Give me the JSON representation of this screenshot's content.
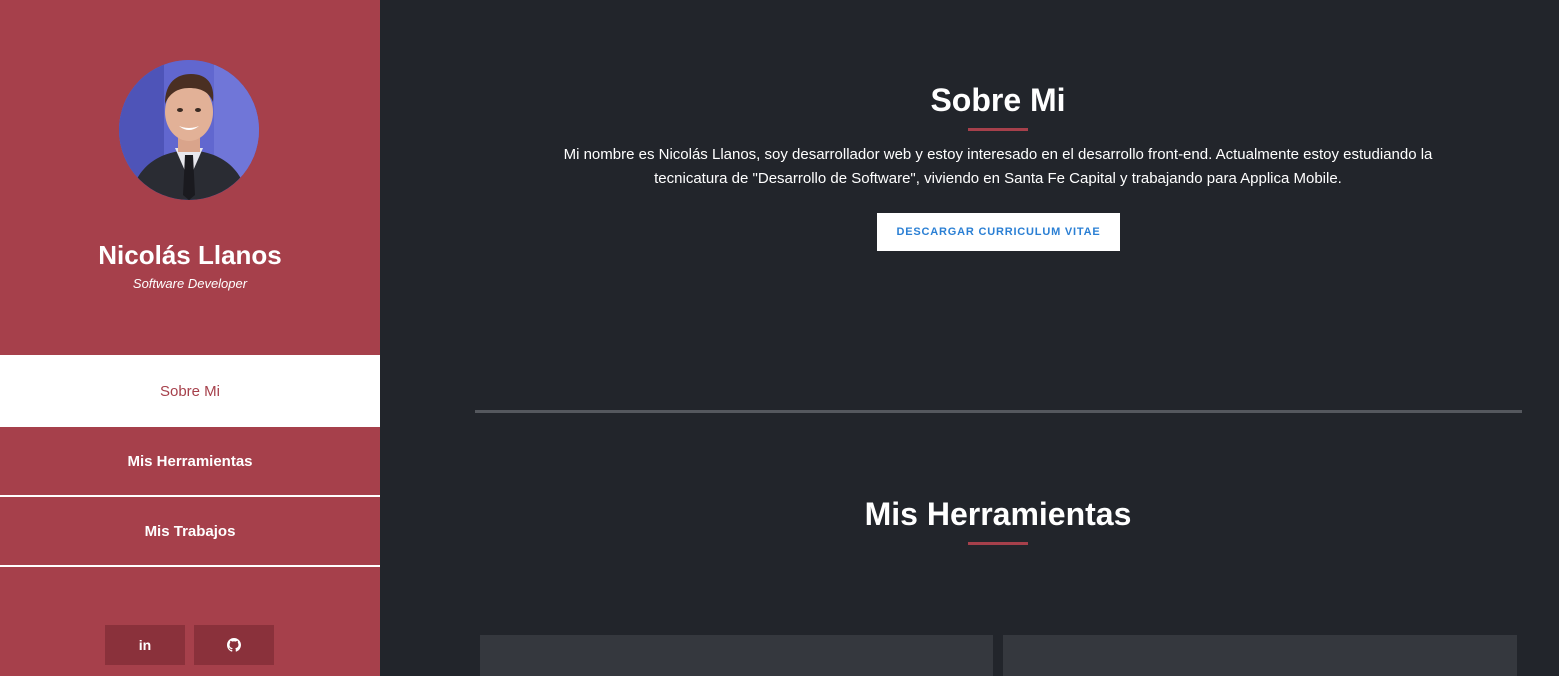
{
  "profile": {
    "name": "Nicolás Llanos",
    "role": "Software Developer",
    "avatar_icon": "profile-photo"
  },
  "nav": {
    "items": [
      {
        "label": "Sobre Mi",
        "active": true
      },
      {
        "label": "Mis Herramientas",
        "active": false
      },
      {
        "label": "Mis Trabajos",
        "active": false
      }
    ]
  },
  "social": {
    "linkedin_label": "in",
    "linkedin_icon": "linkedin-icon",
    "github_icon": "github-icon"
  },
  "about": {
    "title": "Sobre Mi",
    "text": "Mi nombre es Nicolás Llanos, soy desarrollador web y estoy interesado en el desarrollo front-end. Actualmente estoy estudiando la tecnicatura de \"Desarrollo de Software\", viviendo en Santa Fe Capital y trabajando para Applica Mobile.",
    "button_label": "DESCARGAR CURRICULUM VITAE"
  },
  "tools": {
    "title": "Mis Herramientas"
  },
  "colors": {
    "accent": "#a6404b",
    "accent_dark": "#8a313b",
    "background": "#22252b",
    "card": "#35383e",
    "link": "#2a7fd4"
  }
}
